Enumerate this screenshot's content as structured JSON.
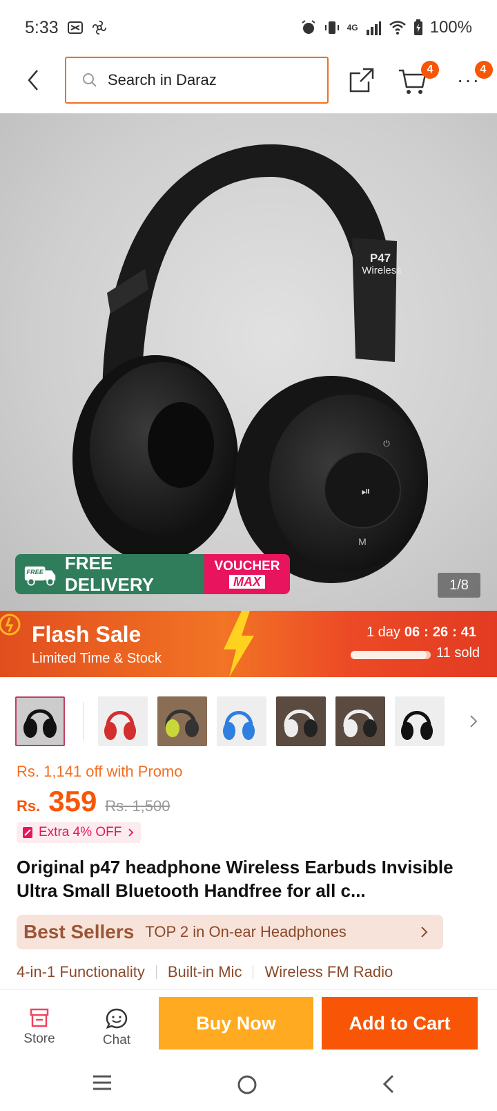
{
  "status_bar": {
    "time": "5:33",
    "battery": "100%",
    "network": "4G"
  },
  "header": {
    "search_placeholder": "Search in Daraz",
    "cart_count": "4",
    "more_count": "4"
  },
  "hero": {
    "brand_print": "P47",
    "brand_print_sub": "Wireless",
    "free_delivery": "FREE DELIVERY",
    "free_tag": "FREE",
    "voucher": "VOUCHER",
    "voucher_max": "MAX",
    "image_counter": "1/8"
  },
  "flash_sale": {
    "title": "Flash Sale",
    "subtitle": "Limited Time & Stock",
    "days": "1 day",
    "hours": "06",
    "minutes": "26",
    "seconds": "41",
    "sold": "11 sold",
    "sold_fraction": 0.95
  },
  "price": {
    "promo_line": "Rs. 1,141 off with Promo",
    "currency": "Rs.",
    "current": "359",
    "original": "Rs. 1,500",
    "extra_off": "Extra 4% OFF"
  },
  "product": {
    "title": "Original p47 headphone Wireless Earbuds Invisible Ultra Small Bluetooth Handfree for all c..."
  },
  "best_sellers": {
    "label": "Best Sellers",
    "rank": "TOP 2 in On-ear Headphones"
  },
  "features": [
    "4-in-1 Functionality",
    "Built-in Mic",
    "Wireless FM Radio"
  ],
  "bottom_bar": {
    "store": "Store",
    "chat": "Chat",
    "buy_now": "Buy Now",
    "add_to_cart": "Add to Cart"
  },
  "colors": {
    "accent": "#f85606",
    "buy": "#ffaa20",
    "free_green": "#2f7d5b",
    "voucher_pink": "#e8155e"
  },
  "icons": [
    "back-icon",
    "search-icon",
    "share-icon",
    "cart-icon",
    "more-icon",
    "store-icon",
    "chat-icon",
    "menu-icon",
    "home-icon",
    "nav-back-icon"
  ]
}
